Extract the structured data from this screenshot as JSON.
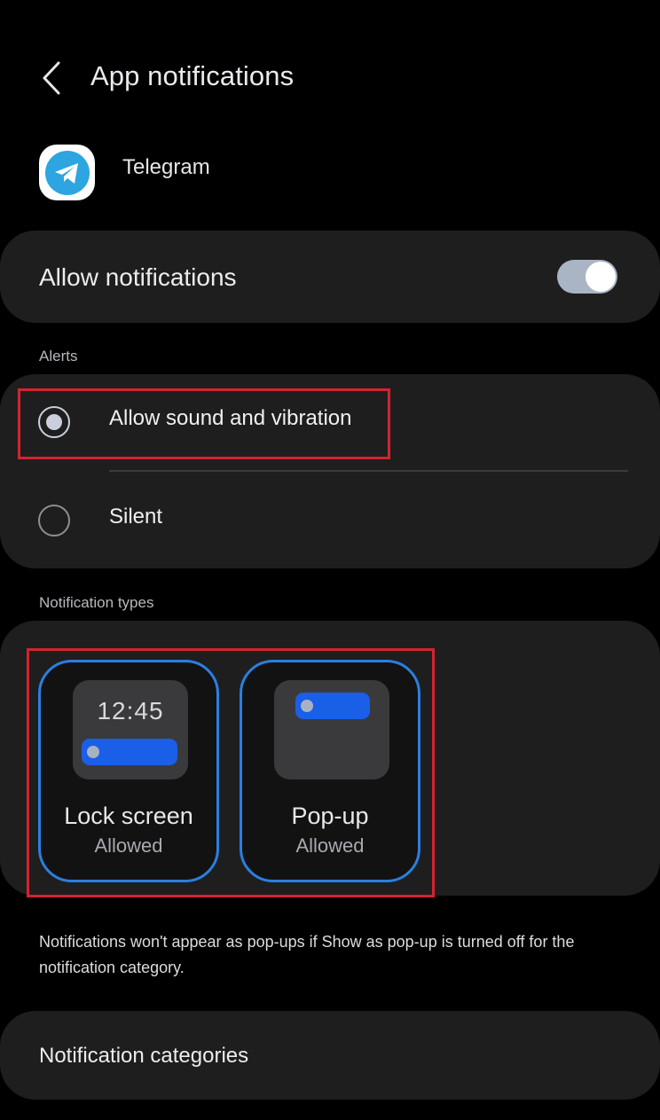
{
  "header": {
    "title": "App notifications"
  },
  "app": {
    "name": "Telegram",
    "icon": "telegram-icon",
    "brand_color": "#2ca5e0"
  },
  "allow_notifications": {
    "label": "Allow notifications",
    "enabled": true
  },
  "alerts": {
    "section_label": "Alerts",
    "options": [
      {
        "label": "Allow sound and vibration",
        "selected": true
      },
      {
        "label": "Silent",
        "selected": false
      }
    ]
  },
  "notification_types": {
    "section_label": "Notification types",
    "items": [
      {
        "title": "Lock screen",
        "status": "Allowed",
        "preview_time": "12:45"
      },
      {
        "title": "Pop-up",
        "status": "Allowed"
      }
    ]
  },
  "note": "Notifications won't appear as pop-ups if Show as pop-up is turned off for the notification category.",
  "categories": {
    "label": "Notification categories"
  },
  "colors": {
    "accent": "#2a7fe0",
    "highlight": "#d32330",
    "card": "#1e1e1e"
  }
}
